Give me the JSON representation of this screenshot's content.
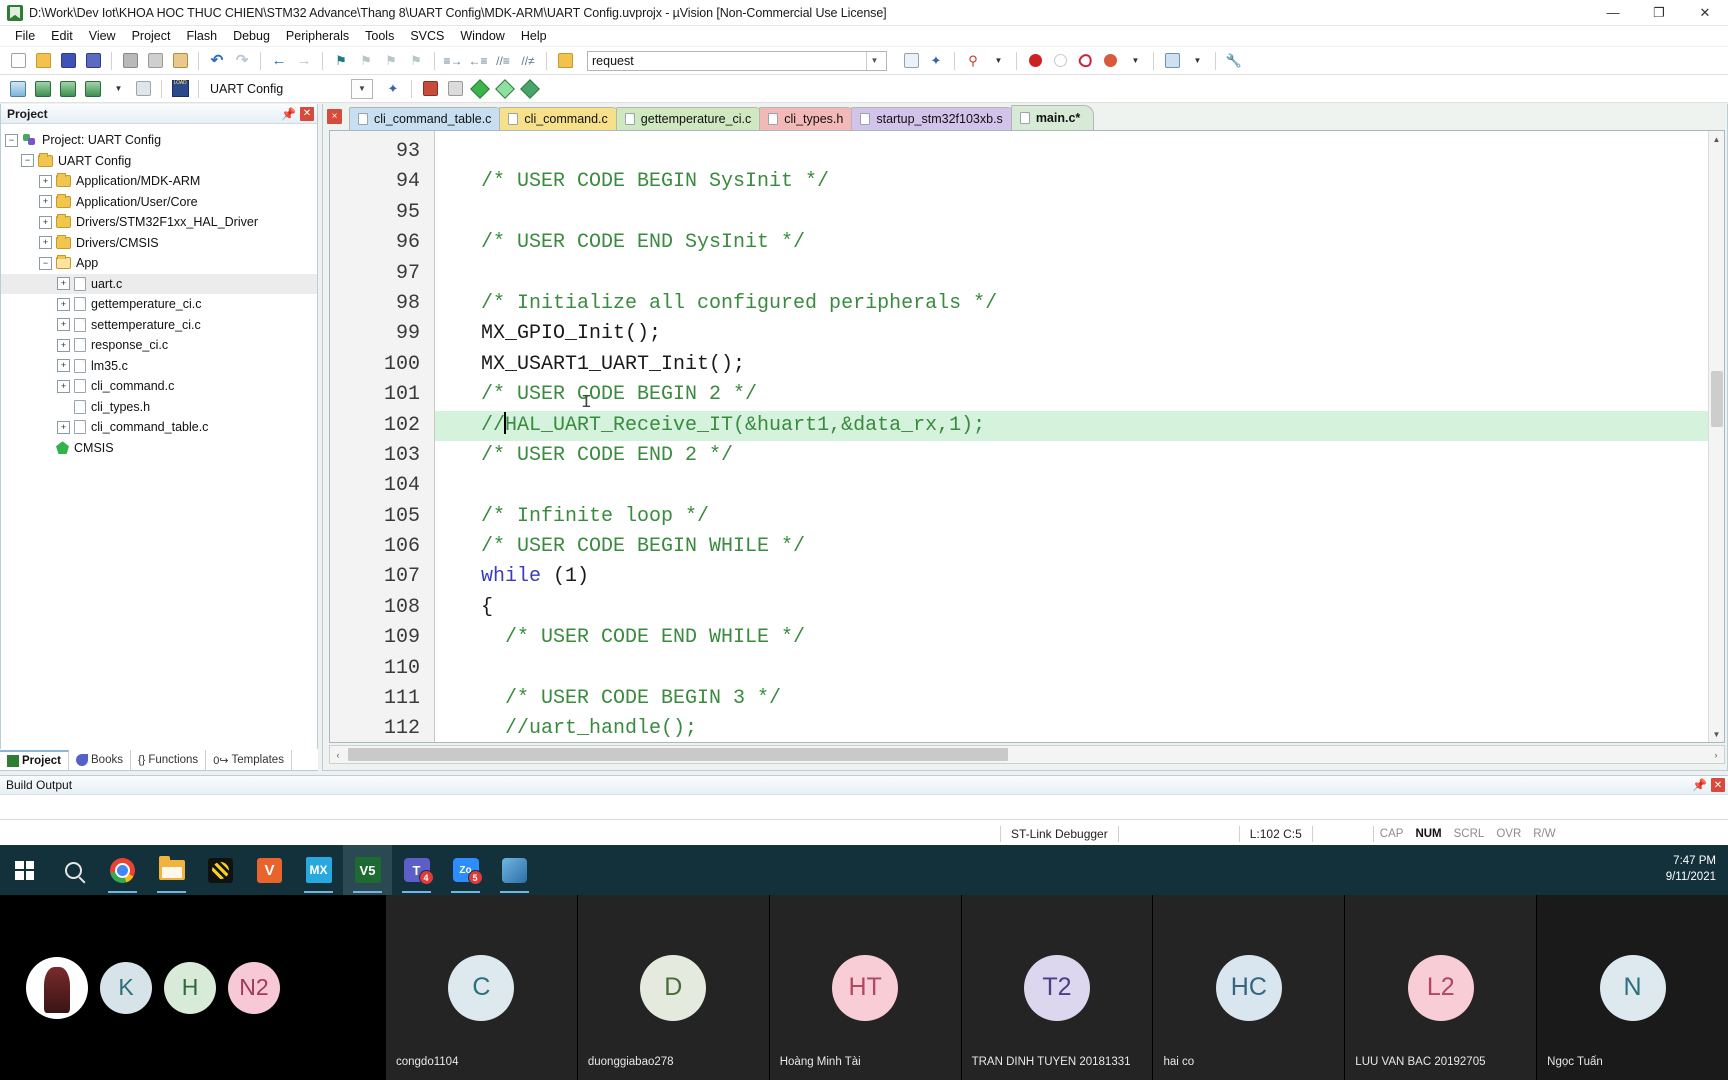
{
  "window": {
    "title": "D:\\Work\\Dev Iot\\KHOA HOC THUC CHIEN\\STM32 Advance\\Thang 8\\UART Config\\MDK-ARM\\UART Config.uvprojx - µVision  [Non-Commercial Use License]",
    "app_icon": "uvision-icon",
    "minimize": "—",
    "maximize": "❐",
    "close": "✕"
  },
  "menu": {
    "items": [
      "File",
      "Edit",
      "View",
      "Project",
      "Flash",
      "Debug",
      "Peripherals",
      "Tools",
      "SVCS",
      "Window",
      "Help"
    ]
  },
  "toolbar2": {
    "target_value": "UART Config",
    "search_value": "request"
  },
  "project_pane": {
    "title": "Project",
    "pin_icon": "pin-icon",
    "close_icon": "close-icon",
    "tree": [
      {
        "label": "Project: UART Config",
        "indent": 0,
        "expander": "−",
        "icon": "project-icon"
      },
      {
        "label": "UART Config",
        "indent": 1,
        "expander": "−",
        "icon": "target-folder-icon"
      },
      {
        "label": "Application/MDK-ARM",
        "indent": 2,
        "expander": "+",
        "icon": "folder-icon"
      },
      {
        "label": "Application/User/Core",
        "indent": 2,
        "expander": "+",
        "icon": "folder-icon"
      },
      {
        "label": "Drivers/STM32F1xx_HAL_Driver",
        "indent": 2,
        "expander": "+",
        "icon": "folder-icon"
      },
      {
        "label": "Drivers/CMSIS",
        "indent": 2,
        "expander": "+",
        "icon": "folder-icon"
      },
      {
        "label": "App",
        "indent": 2,
        "expander": "−",
        "icon": "folder-open-icon"
      },
      {
        "label": "uart.c",
        "indent": 3,
        "expander": "+",
        "icon": "file-icon",
        "selected": true
      },
      {
        "label": "gettemperature_ci.c",
        "indent": 3,
        "expander": "+",
        "icon": "file-icon"
      },
      {
        "label": "settemperature_ci.c",
        "indent": 3,
        "expander": "+",
        "icon": "file-icon"
      },
      {
        "label": "response_ci.c",
        "indent": 3,
        "expander": "+",
        "icon": "file-icon"
      },
      {
        "label": "lm35.c",
        "indent": 3,
        "expander": "+",
        "icon": "file-icon"
      },
      {
        "label": "cli_command.c",
        "indent": 3,
        "expander": "+",
        "icon": "file-icon"
      },
      {
        "label": "cli_types.h",
        "indent": 3,
        "expander": "",
        "icon": "file-icon"
      },
      {
        "label": "cli_command_table.c",
        "indent": 3,
        "expander": "+",
        "icon": "file-icon"
      },
      {
        "label": "CMSIS",
        "indent": 2,
        "expander": "",
        "icon": "cmsis-icon"
      }
    ],
    "tabs": [
      {
        "label": "Project",
        "icon": "project-tab-icon",
        "active": true
      },
      {
        "label": "Books",
        "icon": "books-tab-icon",
        "active": false
      },
      {
        "label": "Functions",
        "icon": "functions-tab-icon",
        "active": false
      },
      {
        "label": "Templates",
        "icon": "templates-tab-icon",
        "active": false
      }
    ]
  },
  "editor": {
    "close_icon": "×",
    "tabs": [
      {
        "label": "cli_command_table.c",
        "color": "#c8dff2",
        "active": false
      },
      {
        "label": "cli_command.c",
        "color": "#f6e08a",
        "active": false
      },
      {
        "label": "gettemperature_ci.c",
        "color": "#cfe8c0",
        "active": false
      },
      {
        "label": "cli_types.h",
        "color": "#f3b8b8",
        "active": false
      },
      {
        "label": "startup_stm32f103xb.s",
        "color": "#d2c3ea",
        "active": false
      },
      {
        "label": "main.c*",
        "color": "#d6ead6",
        "active": true
      }
    ],
    "first_line_number": 93,
    "lines": [
      {
        "n": 93,
        "segments": []
      },
      {
        "n": 94,
        "segments": [
          {
            "t": "  /* USER CODE BEGIN SysInit */",
            "c": "cmt"
          }
        ]
      },
      {
        "n": 95,
        "segments": []
      },
      {
        "n": 96,
        "segments": [
          {
            "t": "  /* USER CODE END SysInit */",
            "c": "cmt"
          }
        ]
      },
      {
        "n": 97,
        "segments": []
      },
      {
        "n": 98,
        "segments": [
          {
            "t": "  /* Initialize all configured peripherals */",
            "c": "cmt"
          }
        ]
      },
      {
        "n": 99,
        "segments": [
          {
            "t": "  MX_GPIO_Init();",
            "c": "pln"
          }
        ]
      },
      {
        "n": 100,
        "segments": [
          {
            "t": "  MX_USART1_UART_Init();",
            "c": "pln"
          }
        ]
      },
      {
        "n": 101,
        "segments": [
          {
            "t": "  /* USER CODE BEGIN 2 */",
            "c": "cmt"
          }
        ]
      },
      {
        "n": 102,
        "segments": [
          {
            "t": "  //",
            "c": "cmt"
          },
          {
            "t": "CARET",
            "c": "caret"
          },
          {
            "t": "HAL_UART_Receive_IT(&huart1,&data_rx,1);",
            "c": "cmt"
          }
        ],
        "modified": true
      },
      {
        "n": 103,
        "segments": [
          {
            "t": "  /* USER CODE END 2 */",
            "c": "cmt"
          }
        ]
      },
      {
        "n": 104,
        "segments": []
      },
      {
        "n": 105,
        "segments": [
          {
            "t": "  /* Infinite loop */",
            "c": "cmt"
          }
        ]
      },
      {
        "n": 106,
        "segments": [
          {
            "t": "  /* USER CODE BEGIN WHILE */",
            "c": "cmt"
          }
        ]
      },
      {
        "n": 107,
        "segments": [
          {
            "t": "  while",
            "c": "kw"
          },
          {
            "t": " (1)",
            "c": "pln"
          }
        ]
      },
      {
        "n": 108,
        "segments": [
          {
            "t": "  {",
            "c": "pln"
          }
        ],
        "fold": "−"
      },
      {
        "n": 109,
        "segments": [
          {
            "t": "    /* USER CODE END WHILE */",
            "c": "cmt"
          }
        ]
      },
      {
        "n": 110,
        "segments": []
      },
      {
        "n": 111,
        "segments": [
          {
            "t": "    /* USER CODE BEGIN 3 */",
            "c": "cmt"
          }
        ]
      },
      {
        "n": 112,
        "segments": [
          {
            "t": "    //uart_handle();",
            "c": "cmt"
          }
        ]
      }
    ]
  },
  "build_output": {
    "title": "Build Output",
    "pin_icon": "pin-icon",
    "close_icon": "close-icon",
    "body": ""
  },
  "statusbar": {
    "debugger": "ST-Link Debugger",
    "position": "L:102 C:5",
    "flags": [
      {
        "label": "CAP",
        "on": false
      },
      {
        "label": "NUM",
        "on": true
      },
      {
        "label": "SCRL",
        "on": false
      },
      {
        "label": "OVR",
        "on": false
      },
      {
        "label": "R/W",
        "on": false
      }
    ]
  },
  "taskbar": {
    "items": [
      {
        "name": "start-button",
        "icon": "windows-logo-icon",
        "running": false,
        "active": false
      },
      {
        "name": "search-button",
        "icon": "search-icon",
        "running": false,
        "active": false
      },
      {
        "name": "chrome-button",
        "icon": "chrome-icon",
        "running": true,
        "active": false
      },
      {
        "name": "file-explorer-button",
        "icon": "folder-icon",
        "running": true,
        "active": false
      },
      {
        "name": "keil-uvision-button",
        "icon": "uvision-icon",
        "running": false,
        "active": false
      },
      {
        "name": "visio-button",
        "icon": "visio-icon",
        "running": false,
        "active": false
      },
      {
        "name": "mx-button",
        "icon": "stm32cubemx-icon",
        "running": true,
        "active": false,
        "label": "MX"
      },
      {
        "name": "vs-button",
        "icon": "v5-icon",
        "running": true,
        "active": true,
        "label": "V5"
      },
      {
        "name": "teams-button",
        "icon": "teams-icon",
        "running": true,
        "active": false,
        "label": "T",
        "badge": "4"
      },
      {
        "name": "zoom-button",
        "icon": "zoom-icon",
        "running": true,
        "active": false,
        "label": "Zo",
        "badge": "5"
      },
      {
        "name": "paint-button",
        "icon": "paint-icon",
        "running": true,
        "active": false
      }
    ],
    "clock_time": "7:47 PM",
    "clock_date": "9/11/2021"
  },
  "meeting": {
    "self_tiles": [
      {
        "initials": "",
        "type": "photo",
        "bg": "#ffffff"
      },
      {
        "initials": "K",
        "type": "text",
        "bg": "#d6e4ea",
        "fg": "#2b6f7a"
      },
      {
        "initials": "H",
        "type": "text",
        "bg": "#d8ead8",
        "fg": "#2f6b3a"
      },
      {
        "initials": "N2",
        "type": "text",
        "bg": "#f7c9d6",
        "fg": "#a03a5a"
      }
    ],
    "participants": [
      {
        "initials": "C",
        "name": "congdo1104",
        "bg": "#dde9ee",
        "fg": "#2b6f7a",
        "cell": "#242424"
      },
      {
        "initials": "D",
        "name": "duonggiabao278",
        "bg": "#e4eade",
        "fg": "#4a6b3a",
        "cell": "#242424"
      },
      {
        "initials": "HT",
        "name": "Hoàng Minh Tài",
        "bg": "#f8cdd6",
        "fg": "#b2475f",
        "cell": "#242424"
      },
      {
        "initials": "T2",
        "name": "TRAN DINH TUYEN 20181331",
        "bg": "#dcd7ee",
        "fg": "#4a3f87",
        "cell": "#242424"
      },
      {
        "initials": "HC",
        "name": "hai co",
        "bg": "#d9e6ef",
        "fg": "#35657f",
        "cell": "#242424"
      },
      {
        "initials": "L2",
        "name": "LUU VAN BAC 20192705",
        "bg": "#f8cdd6",
        "fg": "#b2475f",
        "cell": "#242424"
      },
      {
        "initials": "N",
        "name": "Ngọc Tuấn",
        "bg": "#dde9ee",
        "fg": "#2b6f7a",
        "cell": "#1a1a1a"
      }
    ]
  }
}
